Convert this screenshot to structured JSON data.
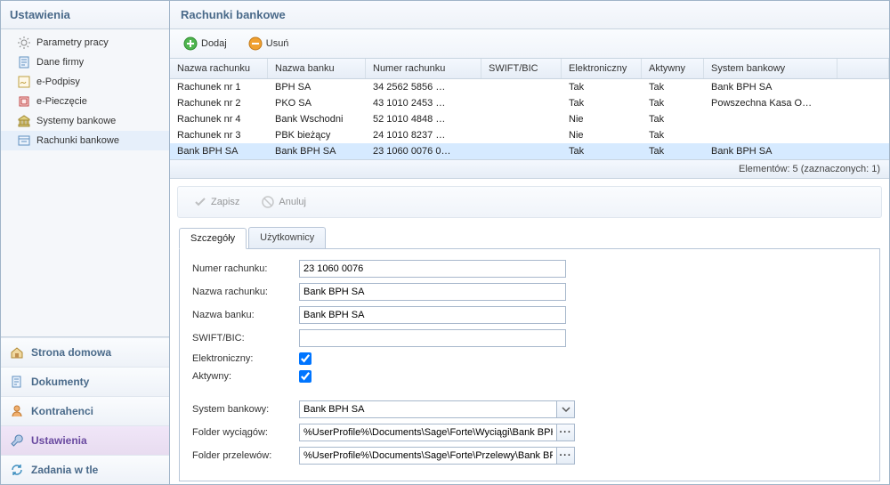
{
  "sidebar": {
    "title": "Ustawienia",
    "tree": [
      {
        "label": "Parametry pracy",
        "icon": "gear"
      },
      {
        "label": "Dane firmy",
        "icon": "doc"
      },
      {
        "label": "e-Podpisy",
        "icon": "sign"
      },
      {
        "label": "e-Pieczęcie",
        "icon": "stamp"
      },
      {
        "label": "Systemy bankowe",
        "icon": "bank"
      },
      {
        "label": "Rachunki bankowe",
        "icon": "accounts",
        "selected": true
      }
    ],
    "nav": [
      {
        "label": "Strona domowa",
        "icon": "home"
      },
      {
        "label": "Dokumenty",
        "icon": "docs"
      },
      {
        "label": "Kontrahenci",
        "icon": "person"
      },
      {
        "label": "Ustawienia",
        "icon": "wrench",
        "active": true
      },
      {
        "label": "Zadania w tle",
        "icon": "refresh"
      }
    ]
  },
  "main": {
    "title": "Rachunki bankowe",
    "toolbar": {
      "add": "Dodaj",
      "remove": "Usuń"
    },
    "grid": {
      "columns": [
        "Nazwa rachunku",
        "Nazwa banku",
        "Numer rachunku",
        "SWIFT/BIC",
        "Elektroniczny",
        "Aktywny",
        "System bankowy"
      ],
      "rows": [
        {
          "cells": [
            "Rachunek nr 1",
            "BPH SA",
            "34 2562 5856  …",
            "",
            "Tak",
            "Tak",
            "Bank BPH SA"
          ]
        },
        {
          "cells": [
            "Rachunek nr 2",
            "PKO SA",
            "43 1010 2453  …",
            "",
            "Tak",
            "Tak",
            "Powszechna Kasa O…"
          ]
        },
        {
          "cells": [
            "Rachunek nr 4",
            "Bank Wschodni",
            "52 1010 4848  …",
            "",
            "Nie",
            "Tak",
            ""
          ]
        },
        {
          "cells": [
            "Rachunek nr 3",
            "PBK bieżący",
            "24 1010 8237  …",
            "",
            "Nie",
            "Tak",
            ""
          ]
        },
        {
          "cells": [
            "Bank BPH SA",
            "Bank BPH SA",
            "23 1060 0076 0…",
            "",
            "Tak",
            "Tak",
            "Bank BPH SA"
          ],
          "selected": true
        }
      ],
      "status": "Elementów: 5 (zaznaczonych: 1)"
    },
    "form_toolbar": {
      "save": "Zapisz",
      "cancel": "Anuluj"
    },
    "tabs": [
      "Szczegóły",
      "Użytkownicy"
    ],
    "form": {
      "numer_rachunku": {
        "label": "Numer rachunku:",
        "value": "23 1060 0076"
      },
      "nazwa_rachunku": {
        "label": "Nazwa rachunku:",
        "value": "Bank BPH SA"
      },
      "nazwa_banku": {
        "label": "Nazwa banku:",
        "value": "Bank BPH SA"
      },
      "swift": {
        "label": "SWIFT/BIC:",
        "value": ""
      },
      "elektroniczny": {
        "label": "Elektroniczny:",
        "checked": true
      },
      "aktywny": {
        "label": "Aktywny:",
        "checked": true
      },
      "system_bankowy": {
        "label": "System bankowy:",
        "value": "Bank BPH SA"
      },
      "folder_wyciagow": {
        "label": "Folder wyciągów:",
        "value": "%UserProfile%\\Documents\\Sage\\Forte\\Wyciągi\\Bank BPH"
      },
      "folder_przelewow": {
        "label": "Folder przelewów:",
        "value": "%UserProfile%\\Documents\\Sage\\Forte\\Przelewy\\Bank BPH"
      }
    }
  }
}
